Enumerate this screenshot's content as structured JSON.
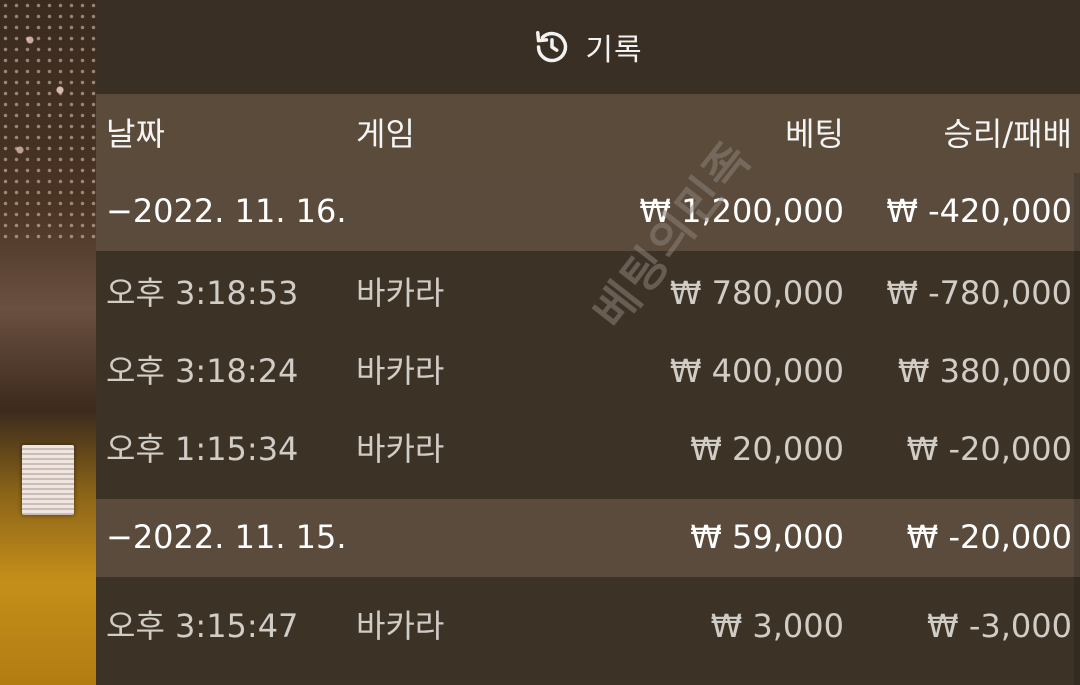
{
  "header": {
    "icon": "history-icon",
    "title": "기록"
  },
  "columns": {
    "date": "날짜",
    "game": "게임",
    "bet": "베팅",
    "result": "승리/패배"
  },
  "days": [
    {
      "date": "−2022. 11. 16.",
      "bet": "₩ 1,200,000",
      "result": "₩ -420,000",
      "entries": [
        {
          "time": "오후 3:18:53",
          "game": "바카라",
          "bet": "₩ 780,000",
          "result": "₩ -780,000"
        },
        {
          "time": "오후 3:18:24",
          "game": "바카라",
          "bet": "₩ 400,000",
          "result": "₩ 380,000"
        },
        {
          "time": "오후 1:15:34",
          "game": "바카라",
          "bet": "₩ 20,000",
          "result": "₩ -20,000"
        }
      ]
    },
    {
      "date": "−2022. 11. 15.",
      "bet": "₩ 59,000",
      "result": "₩ -20,000",
      "entries": [
        {
          "time": "오후 3:15:47",
          "game": "바카라",
          "bet": "₩ 3,000",
          "result": "₩ -3,000"
        }
      ]
    }
  ],
  "watermark": "베팅의민족",
  "colors": {
    "panel": "#3d3226",
    "header_row": "#5a4b3b",
    "day_row": "#5a4b3c",
    "text_primary": "#ffffff",
    "text_secondary": "#d0ccc6"
  }
}
